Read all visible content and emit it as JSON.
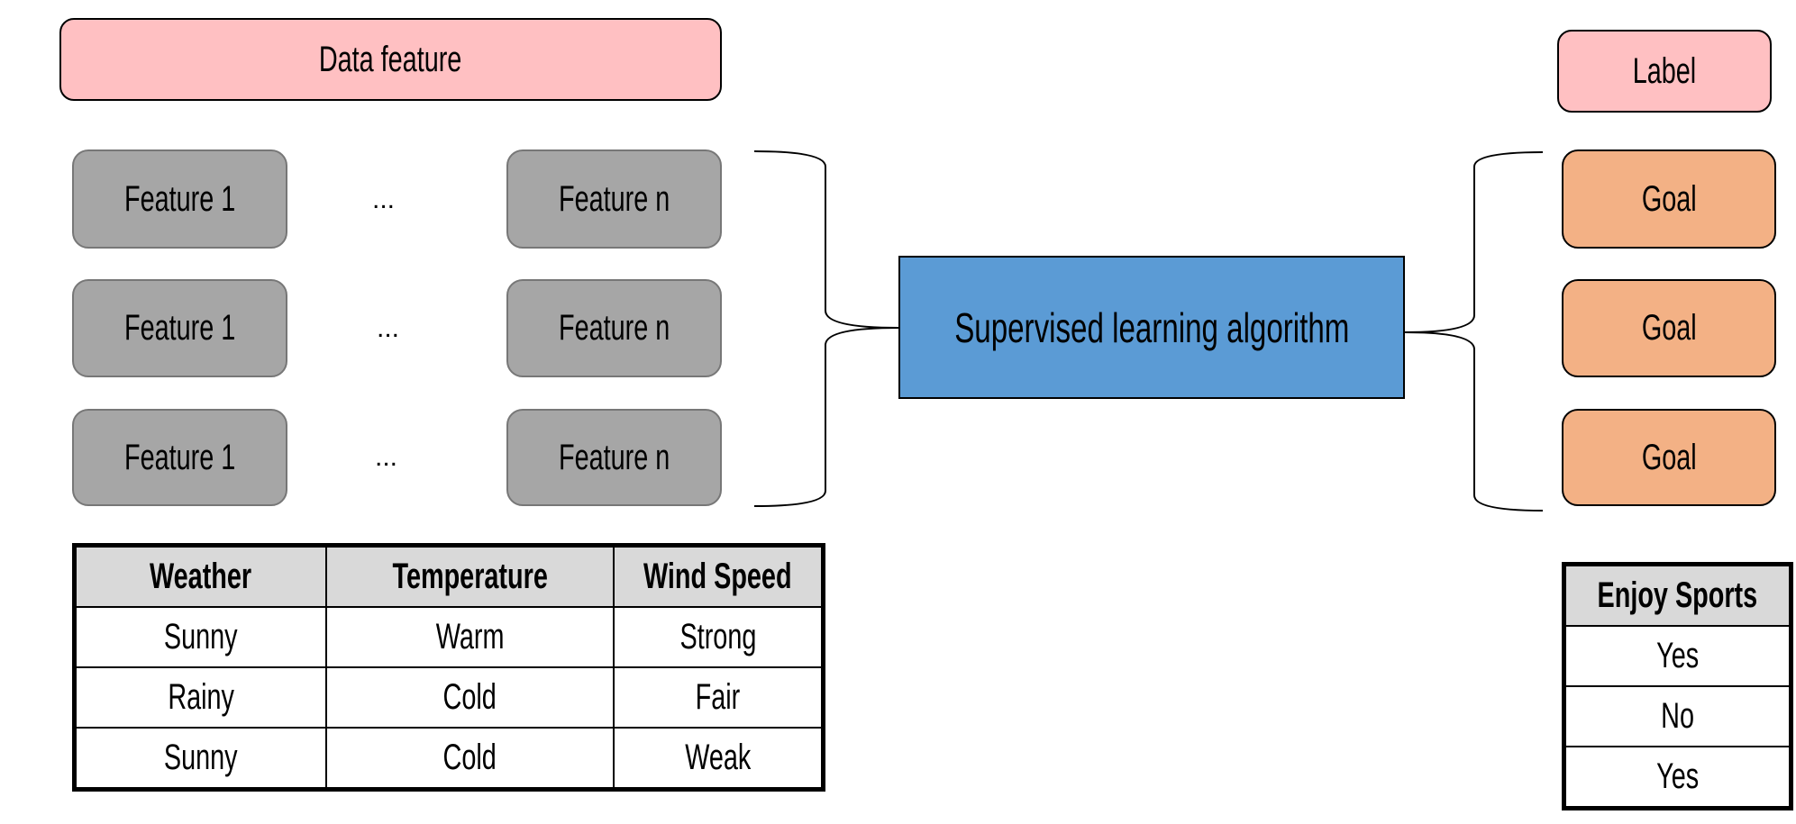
{
  "header": {
    "data_feature": "Data feature",
    "label": "Label"
  },
  "features": [
    [
      "Feature 1",
      "...",
      "Feature n"
    ],
    [
      "Feature 1",
      "...",
      "Feature n"
    ],
    [
      "Feature 1",
      "...",
      "Feature n"
    ]
  ],
  "algorithm": "Supervised learning algorithm",
  "goals": [
    "Goal",
    "Goal",
    "Goal"
  ],
  "feature_table": {
    "headers": [
      "Weather",
      "Temperature",
      "Wind Speed"
    ],
    "rows": [
      [
        "Sunny",
        "Warm",
        "Strong"
      ],
      [
        "Rainy",
        "Cold",
        "Fair"
      ],
      [
        "Sunny",
        "Cold",
        "Weak"
      ]
    ]
  },
  "label_table": {
    "header": "Enjoy Sports",
    "rows": [
      "Yes",
      "No",
      "Yes"
    ]
  },
  "colors": {
    "pink": "#ffc0c2",
    "gray": "#a6a6a6",
    "blue": "#5b9bd5",
    "orange": "#f3b185"
  }
}
